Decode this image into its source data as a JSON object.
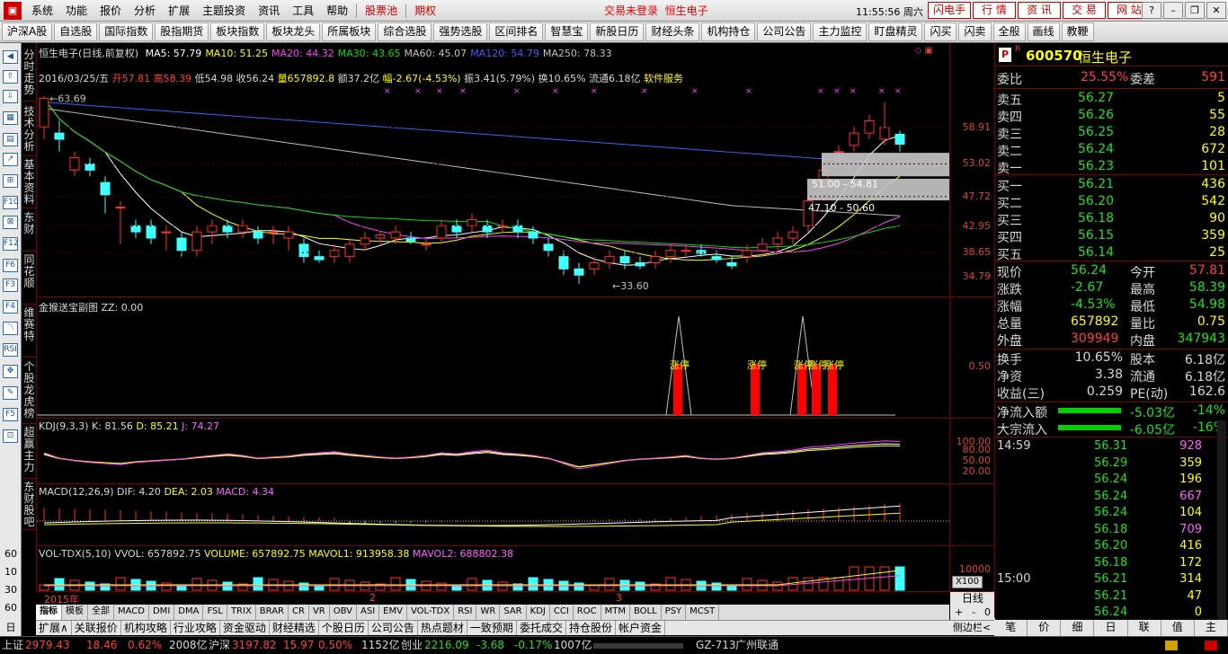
{
  "menubar": {
    "items": [
      "系统",
      "功能",
      "报价",
      "分析",
      "扩展",
      "主题投资",
      "资讯",
      "工具",
      "帮助"
    ],
    "red_items": [
      "股票池",
      "期权"
    ],
    "login_status": "交易未登录",
    "login_stock": "恒生电子",
    "clock": "11:55:56 周六",
    "right_buttons": [
      "闪电手",
      "行 情",
      "资 讯",
      "交 易",
      "网 站"
    ]
  },
  "toolbar": {
    "items": [
      "沪深A股",
      "自选股",
      "国际指数",
      "股指期货",
      "板块指数",
      "板块龙头",
      "所属板块",
      "综合选股",
      "强势选股",
      "区间排名",
      "智慧宝",
      "新股日历",
      "财经头条",
      "机构持仓",
      "公司公告",
      "主力监控",
      "盯盘精灵",
      "闪买",
      "闪卖",
      "全般",
      "画线",
      "教鞭"
    ]
  },
  "leftbar": {
    "vtabs": [
      "分时走势",
      "技术分析",
      "基本资料",
      "东财",
      "同花顺",
      "维赛特",
      "个股龙虎榜",
      "超赢主力",
      "东财股吧"
    ],
    "icons": [
      "◀",
      "⇧",
      "⇩",
      "▦",
      "▤",
      "↗",
      "⊞",
      "F10",
      "⊠",
      "F12",
      "F6",
      "F3",
      "F4",
      "〽",
      "RSI",
      "✥",
      "✎",
      "F5",
      "⊡"
    ],
    "numbers": [
      "60",
      "10",
      "30",
      "60",
      "日",
      "周"
    ]
  },
  "main_chart": {
    "title": "恒生电子(日线,前复权)",
    "ma": [
      {
        "label": "MA5: 57.79",
        "color": "#ffffff"
      },
      {
        "label": "MA10: 51.25",
        "color": "#ffff00"
      },
      {
        "label": "MA20: 44.32",
        "color": "#ff40ff"
      },
      {
        "label": "MA30: 43.65",
        "color": "#00e000"
      },
      {
        "label": "MA60: 45.07",
        "color": "#c0c0c0"
      },
      {
        "label": "MA120: 54.79",
        "color": "#4060ff"
      },
      {
        "label": "MA250: 78.33",
        "color": "#c0c0c0"
      }
    ],
    "info": {
      "date": "2016/03/25/五",
      "open": "开57.81",
      "high": "高58.39",
      "low": "低54.98",
      "close": "收56.24",
      "vol": "量657892.8",
      "amount": "额37.2亿",
      "chg": "幅-2.67(-4.53%)",
      "amp": "振3.41(5.79%)",
      "turn": "换10.65%",
      "float": "流通6.18亿",
      "sector": "软件服务"
    },
    "annotations": {
      "high": "63.69",
      "low": "33.60",
      "gap1": "51.00 - 54.81",
      "gap2": "47.10 - 50.60"
    },
    "y_axis": [
      "58.91",
      "53.02",
      "47.72",
      "42.95",
      "38.65",
      "34.79"
    ]
  },
  "sub1": {
    "title": "金猴送宝副图",
    "value": "ZZ: 0.00",
    "axis": "0.50",
    "tags": [
      "涨停",
      "涨停",
      "涨停",
      "涨停",
      "涨停"
    ]
  },
  "kdj": {
    "title": "KDJ(9,3,3)",
    "k": "K: 81.56",
    "d": "D: 85.21",
    "j": "J: 74.27",
    "axis": [
      "100.00",
      "80.00",
      "50.00",
      "20.00"
    ]
  },
  "macd": {
    "title": "MACD(12,26,9)",
    "dif": "DIF: 4.20",
    "dea": "DEA: 2.03",
    "macd": "MACD: 4.34"
  },
  "vol": {
    "title": "VOL-TDX(5,10)",
    "vvol": "VVOL: 657892.75",
    "volume": "VOLUME: 657892.75",
    "mavol1": "MAVOL1: 913958.38",
    "mavol2": "MAVOL2: 688802.38",
    "axis": "10000",
    "unit": "X100"
  },
  "time_axis": {
    "labels": [
      "2015年",
      "2",
      "3"
    ]
  },
  "index_tabs": [
    "指标",
    "模板",
    "全部",
    "MACD",
    "DMI",
    "DMA",
    "FSL",
    "TRIX",
    "BRAR",
    "CR",
    "VR",
    "OBV",
    "ASI",
    "EMV",
    "VOL-TDX",
    "RSI",
    "WR",
    "SAR",
    "KDJ",
    "CCI",
    "ROC",
    "MTM",
    "BOLL",
    "PSY",
    "MCST"
  ],
  "period_label": "日线",
  "bottom_tabs": [
    "扩展∧",
    "关联报价",
    "机构攻略",
    "行业攻略",
    "资金驱动",
    "财经精选",
    "个股日历",
    "公司公告",
    "热点题材",
    "一致预期",
    "委托成交",
    "持仓股份",
    "帐户资金"
  ],
  "side_toggle": "侧边栏<",
  "quote": {
    "badge": "R",
    "code": "600570",
    "name": "恒生电子",
    "weibi_label": "委比",
    "weibi": "25.55%",
    "weicha_label": "委差",
    "weicha": "591",
    "asks": [
      {
        "l": "卖五",
        "p": "56.27",
        "v": "5"
      },
      {
        "l": "卖四",
        "p": "56.26",
        "v": "55"
      },
      {
        "l": "卖三",
        "p": "56.25",
        "v": "28"
      },
      {
        "l": "卖二",
        "p": "56.24",
        "v": "672"
      },
      {
        "l": "卖一",
        "p": "56.23",
        "v": "101"
      }
    ],
    "bids": [
      {
        "l": "买一",
        "p": "56.21",
        "v": "436"
      },
      {
        "l": "买二",
        "p": "56.20",
        "v": "542"
      },
      {
        "l": "买三",
        "p": "56.18",
        "v": "90"
      },
      {
        "l": "买四",
        "p": "56.15",
        "v": "359"
      },
      {
        "l": "买五",
        "p": "56.14",
        "v": "25"
      }
    ],
    "stats": [
      {
        "l1": "现价",
        "v1": "56.24",
        "c1": "dn",
        "l2": "今开",
        "v2": "57.81",
        "c2": "up"
      },
      {
        "l1": "涨跌",
        "v1": "-2.67",
        "c1": "dn",
        "l2": "最高",
        "v2": "58.39",
        "c2": "dn"
      },
      {
        "l1": "涨幅",
        "v1": "-4.53%",
        "c1": "dn",
        "l2": "最低",
        "v2": "54.98",
        "c2": "dn"
      },
      {
        "l1": "总量",
        "v1": "657892",
        "c1": "yl",
        "l2": "量比",
        "v2": "0.75",
        "c2": "yl"
      },
      {
        "l1": "外盘",
        "v1": "309949",
        "c1": "up",
        "l2": "内盘",
        "v2": "347943",
        "c2": "dn"
      }
    ],
    "stats2": [
      {
        "l1": "换手",
        "v1": "10.65%",
        "l2": "股本",
        "v2": "6.18亿"
      },
      {
        "l1": "净资",
        "v1": "3.38",
        "l2": "流通",
        "v2": "6.18亿"
      },
      {
        "l1": "收益(三)",
        "v1": "0.259",
        "l2": "PE(动)",
        "v2": "162.6"
      }
    ],
    "flows": [
      {
        "l": "净流入额",
        "v": "-5.03亿",
        "p": "-14%"
      },
      {
        "l": "大宗流入",
        "v": "-6.05亿",
        "p": "-16%"
      }
    ],
    "ticks": [
      {
        "t": "14:59",
        "p": "56.31",
        "v": "928",
        "bs": "B",
        "c": "mg"
      },
      {
        "t": "",
        "p": "56.29",
        "v": "359",
        "bs": "S",
        "c": "yl"
      },
      {
        "t": "",
        "p": "56.24",
        "v": "196",
        "bs": "S",
        "c": "yl"
      },
      {
        "t": "",
        "p": "56.24",
        "v": "667",
        "bs": "S",
        "c": "mg"
      },
      {
        "t": "",
        "p": "56.24",
        "v": "104",
        "bs": "S",
        "c": "yl"
      },
      {
        "t": "",
        "p": "56.18",
        "v": "709",
        "bs": "S",
        "c": "mg"
      },
      {
        "t": "",
        "p": "56.20",
        "v": "416",
        "bs": "B",
        "c": "yl"
      },
      {
        "t": "",
        "p": "56.18",
        "v": "172",
        "bs": "B",
        "c": "yl"
      },
      {
        "t": "15:00",
        "p": "56.21",
        "v": "314",
        "bs": "B",
        "c": "yl"
      },
      {
        "t": "",
        "p": "56.21",
        "v": "47",
        "bs": "S",
        "c": "yl"
      },
      {
        "t": "",
        "p": "56.24",
        "v": "0",
        "bs": "S",
        "c": "yl"
      }
    ],
    "tabs": [
      "笔",
      "价",
      "细",
      "日",
      "联",
      "值",
      "主"
    ]
  },
  "statusbar": {
    "sh_label": "上证",
    "sh": "2979.43",
    "sh_chg": "18.46",
    "sh_pct": "0.62%",
    "sh_amt": "2008亿",
    "hs_label": "沪深",
    "hs": "3197.82",
    "hs_chg": "15.97",
    "hs_pct": "0.50%",
    "hs_amt": "1152亿",
    "cy_label": "创业",
    "cy": "2216.09",
    "cy_chg": "-3.68",
    "cy_pct": "-0.17%",
    "cy_amt": "1007亿",
    "server": "GZ-713",
    "isp": "广州联通"
  },
  "chart_data": {
    "type": "candlestick",
    "ohlc": [
      [
        59,
        64,
        57,
        63.6
      ],
      [
        58,
        60,
        55,
        57
      ],
      [
        52,
        55,
        51,
        54
      ],
      [
        53,
        54,
        51,
        52
      ],
      [
        50,
        51,
        45,
        48
      ],
      [
        46,
        47,
        40,
        46
      ],
      [
        43,
        44,
        41,
        42
      ],
      [
        43,
        44,
        40,
        41
      ],
      [
        42,
        43,
        39,
        42
      ],
      [
        41,
        42,
        38,
        39
      ],
      [
        39,
        43,
        38,
        42
      ],
      [
        42,
        44,
        40,
        43
      ],
      [
        43,
        44,
        41,
        42
      ],
      [
        42,
        44,
        41,
        43
      ],
      [
        42,
        43,
        40,
        41
      ],
      [
        42,
        43,
        40,
        42
      ],
      [
        41,
        43,
        39,
        42
      ],
      [
        40,
        41,
        37,
        38
      ],
      [
        38,
        39,
        37,
        37.5
      ],
      [
        38,
        40,
        37,
        39
      ],
      [
        38,
        41,
        37,
        40
      ],
      [
        40,
        42,
        39,
        41
      ],
      [
        41,
        42,
        40,
        41.5
      ],
      [
        41,
        43,
        40,
        42
      ],
      [
        41,
        42,
        40,
        40.5
      ],
      [
        40,
        41,
        39,
        40
      ],
      [
        41,
        44,
        40,
        43
      ],
      [
        43,
        44,
        41,
        42
      ],
      [
        43,
        45,
        42,
        44
      ],
      [
        43,
        44,
        41,
        42
      ],
      [
        43,
        44,
        42,
        43
      ],
      [
        43,
        44,
        41,
        42
      ],
      [
        42,
        43,
        40,
        41
      ],
      [
        40,
        41,
        38,
        39
      ],
      [
        38,
        39,
        35,
        36
      ],
      [
        36,
        37,
        33.6,
        35
      ],
      [
        36,
        38,
        35,
        37
      ],
      [
        37,
        39,
        36,
        38
      ],
      [
        38,
        39,
        36,
        37
      ],
      [
        37,
        38,
        36,
        36.5
      ],
      [
        37,
        39,
        36,
        38
      ],
      [
        38,
        40,
        37,
        39
      ],
      [
        39,
        40,
        38,
        39
      ],
      [
        39,
        40,
        38,
        38.5
      ],
      [
        38,
        39,
        37,
        37.5
      ],
      [
        37,
        38,
        36,
        36.5
      ],
      [
        38,
        40,
        37,
        39
      ],
      [
        39,
        41,
        38,
        40
      ],
      [
        40,
        42,
        39,
        41
      ],
      [
        41,
        43,
        40,
        42
      ],
      [
        43,
        48,
        42,
        47
      ],
      [
        50,
        54,
        49,
        52
      ],
      [
        55,
        56,
        54,
        55
      ],
      [
        56,
        59,
        55,
        58
      ],
      [
        58,
        61,
        57,
        60
      ],
      [
        57,
        63,
        56,
        58.9
      ],
      [
        57.8,
        58.4,
        55,
        56.2
      ]
    ],
    "ma5": "MA5: 57.79",
    "ma10": "MA10: 51.25",
    "ma20": "MA20: 44.32",
    "ma30": "MA30: 43.65",
    "ma60": "MA60: 45.07",
    "ma120": "MA120: 54.79",
    "ma250": "MA250: 78.33",
    "yticks": [
      58.91,
      53.02,
      47.72,
      42.95,
      38.65,
      34.79
    ],
    "ylim": [
      33,
      65
    ]
  }
}
